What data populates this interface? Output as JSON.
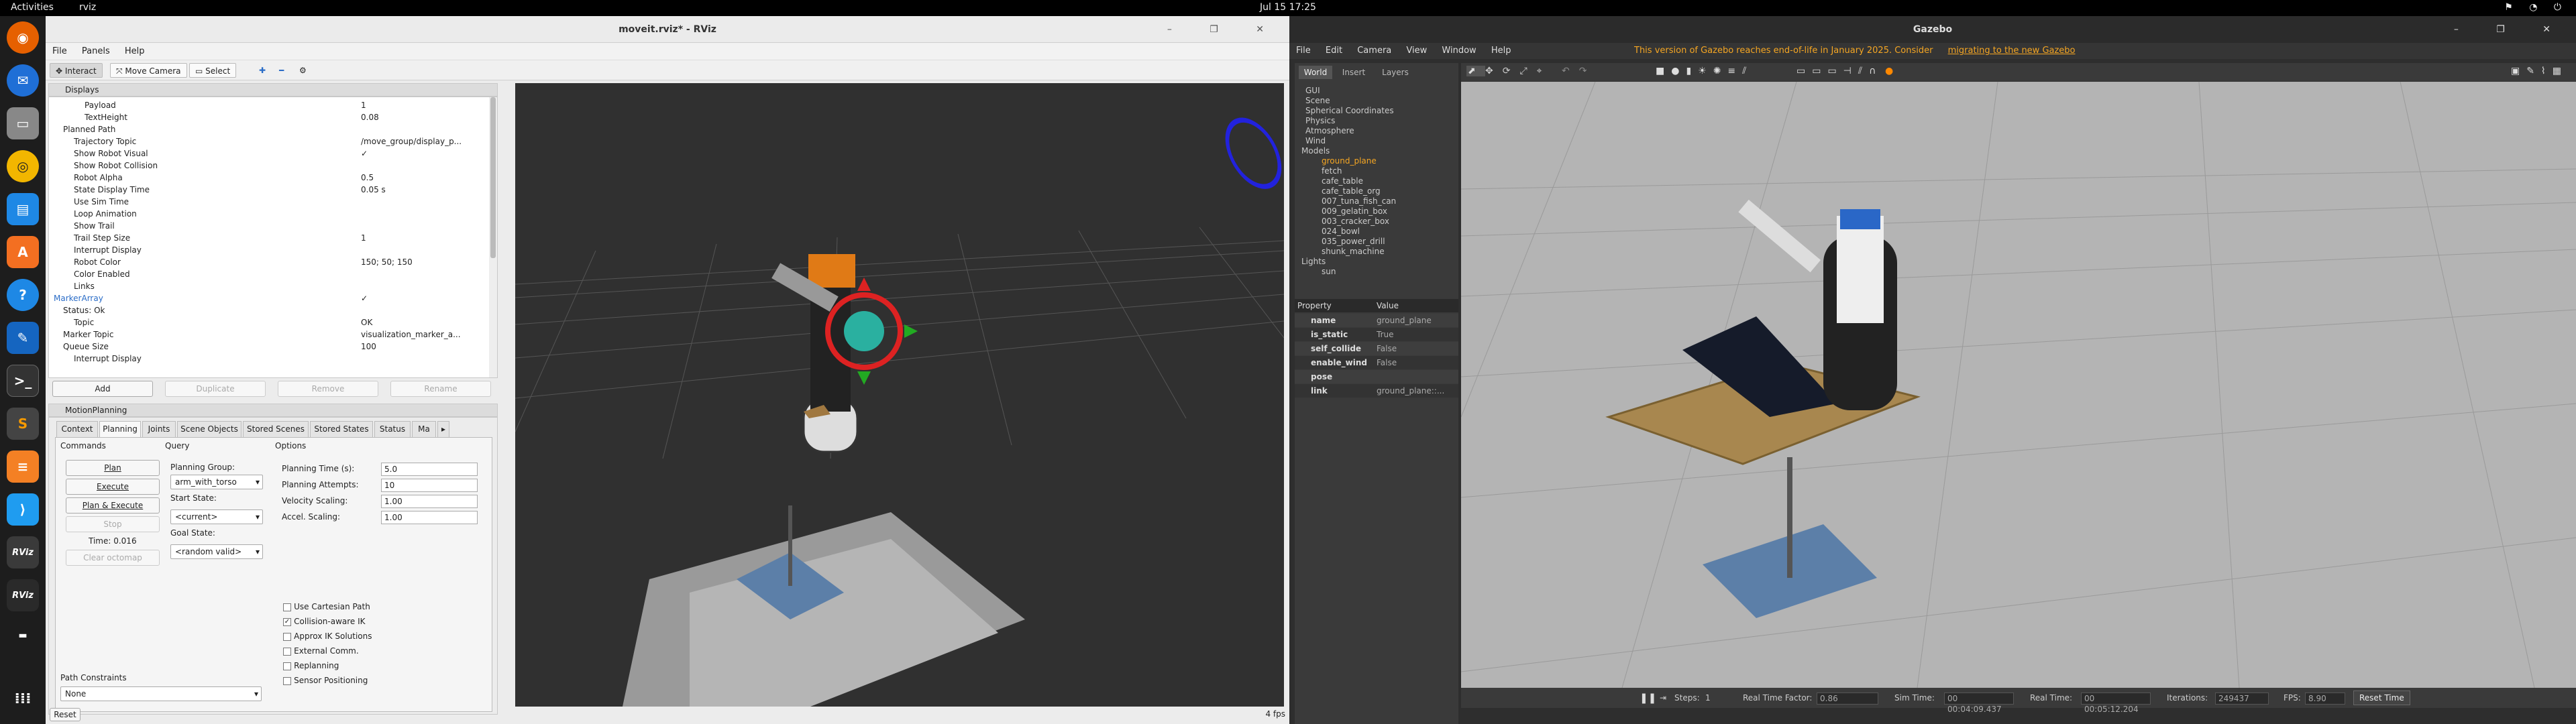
{
  "topbar": {
    "activities": "Activities",
    "app": "rviz",
    "clock": "Jul 15  17:25"
  },
  "dock": {
    "items": [
      "firefox-icon",
      "thunderbird-icon",
      "files-icon",
      "rhythmbox-icon",
      "writer-icon",
      "software-icon",
      "help-icon",
      "text-editor-icon",
      "terminal-icon",
      "sublime-icon",
      "stack-icon",
      "vscode-icon",
      "rviz-icon",
      "rviz-icon",
      "apps-grid-icon"
    ]
  },
  "rviz": {
    "title": "moveit.rviz* - RViz",
    "menu": [
      "File",
      "Panels",
      "Help"
    ],
    "toolbar": {
      "interact": "Interact",
      "move_camera": "Move Camera",
      "select": "Select"
    },
    "displays_title": "Displays",
    "tree": [
      {
        "label": "Payload",
        "value": "1"
      },
      {
        "label": "TextHeight",
        "value": "0.08"
      },
      {
        "label": "Planned Path",
        "value": ""
      },
      {
        "label": "Trajectory Topic",
        "value": "/move_group/display_p..."
      },
      {
        "label": "Show Robot Visual",
        "value": "✓"
      },
      {
        "label": "Show Robot Collision",
        "value": ""
      },
      {
        "label": "Robot Alpha",
        "value": "0.5"
      },
      {
        "label": "State Display Time",
        "value": "0.05 s"
      },
      {
        "label": "Use Sim Time",
        "value": ""
      },
      {
        "label": "Loop Animation",
        "value": ""
      },
      {
        "label": "Show Trail",
        "value": ""
      },
      {
        "label": "Trail Step Size",
        "value": "1"
      },
      {
        "label": "Interrupt Display",
        "value": ""
      },
      {
        "label": "Robot Color",
        "value": "150; 50; 150"
      },
      {
        "label": "Color Enabled",
        "value": ""
      },
      {
        "label": "Links",
        "value": ""
      },
      {
        "label": "MarkerArray",
        "value": "✓"
      },
      {
        "label": "Status: Ok",
        "value": ""
      },
      {
        "label": "Topic",
        "value": "OK"
      },
      {
        "label": "Marker Topic",
        "value": "visualization_marker_a..."
      },
      {
        "label": "Queue Size",
        "value": "100"
      },
      {
        "label": "Interrupt Display",
        "value": ""
      }
    ],
    "display_buttons": [
      "Add",
      "Duplicate",
      "Remove",
      "Rename"
    ],
    "motion_title": "MotionPlanning",
    "tabs": [
      "Context",
      "Planning",
      "Joints",
      "Scene Objects",
      "Stored Scenes",
      "Stored States",
      "Status",
      "Ma"
    ],
    "commands_label": "Commands",
    "query_label": "Query",
    "options_label": "Options",
    "cmd_buttons": [
      "Plan",
      "Execute",
      "Plan & Execute",
      "Stop",
      "Clear octomap"
    ],
    "time_label": "Time: 0.016",
    "planning_group_label": "Planning Group:",
    "planning_group": "arm_with_torso",
    "start_state_label": "Start State:",
    "start_state": "<current>",
    "goal_state_label": "Goal State:",
    "goal_state": "<random valid>",
    "options": [
      {
        "label": "Planning Time (s):",
        "value": "5.0"
      },
      {
        "label": "Planning Attempts:",
        "value": "10"
      },
      {
        "label": "Velocity Scaling:",
        "value": "1.00"
      },
      {
        "label": "Accel. Scaling:",
        "value": "1.00"
      }
    ],
    "checks": [
      {
        "label": "Use Cartesian Path",
        "checked": false
      },
      {
        "label": "Collision-aware IK",
        "checked": true
      },
      {
        "label": "Approx IK Solutions",
        "checked": false
      },
      {
        "label": "External Comm.",
        "checked": false
      },
      {
        "label": "Replanning",
        "checked": false
      },
      {
        "label": "Sensor Positioning",
        "checked": false
      }
    ],
    "path_constraints_label": "Path Constraints",
    "path_constraints": "None",
    "reset": "Reset",
    "fps": "4 fps"
  },
  "gazebo": {
    "title": "Gazebo",
    "menu": [
      "File",
      "Edit",
      "Camera",
      "View",
      "Window",
      "Help"
    ],
    "notice_text": "This version of Gazebo reaches end-of-life in January 2025. Consider ",
    "notice_link": "migrating to the new Gazebo",
    "tabs": [
      "World",
      "Insert",
      "Layers"
    ],
    "world_items": [
      "GUI",
      "Scene",
      "Spherical Coordinates",
      "Physics",
      "Atmosphere",
      "Wind"
    ],
    "models_label": "Models",
    "models": [
      "ground_plane",
      "fetch",
      "cafe_table",
      "cafe_table_org",
      "007_tuna_fish_can",
      "009_gelatin_box",
      "003_cracker_box",
      "024_bowl",
      "035_power_drill",
      "shunk_machine"
    ],
    "lights_label": "Lights",
    "lights": [
      "sun"
    ],
    "prop_header": [
      "Property",
      "Value"
    ],
    "props": [
      {
        "name": "name",
        "value": "ground_plane"
      },
      {
        "name": "is_static",
        "value": "True"
      },
      {
        "name": "self_collide",
        "value": "False"
      },
      {
        "name": "enable_wind",
        "value": "False"
      },
      {
        "name": "pose",
        "value": ""
      },
      {
        "name": "link",
        "value": "ground_plane::..."
      }
    ],
    "bottom": {
      "steps_label": "Steps:",
      "steps": "1",
      "rtf_label": "Real Time Factor:",
      "rtf": "0.86",
      "sim_label": "Sim Time:",
      "sim": "00 00:04:09.437",
      "real_label": "Real Time:",
      "real": "00 00:05:12.204",
      "iter_label": "Iterations:",
      "iter": "249437",
      "fps_label": "FPS:",
      "fps": "8.90",
      "reset": "Reset Time"
    }
  }
}
